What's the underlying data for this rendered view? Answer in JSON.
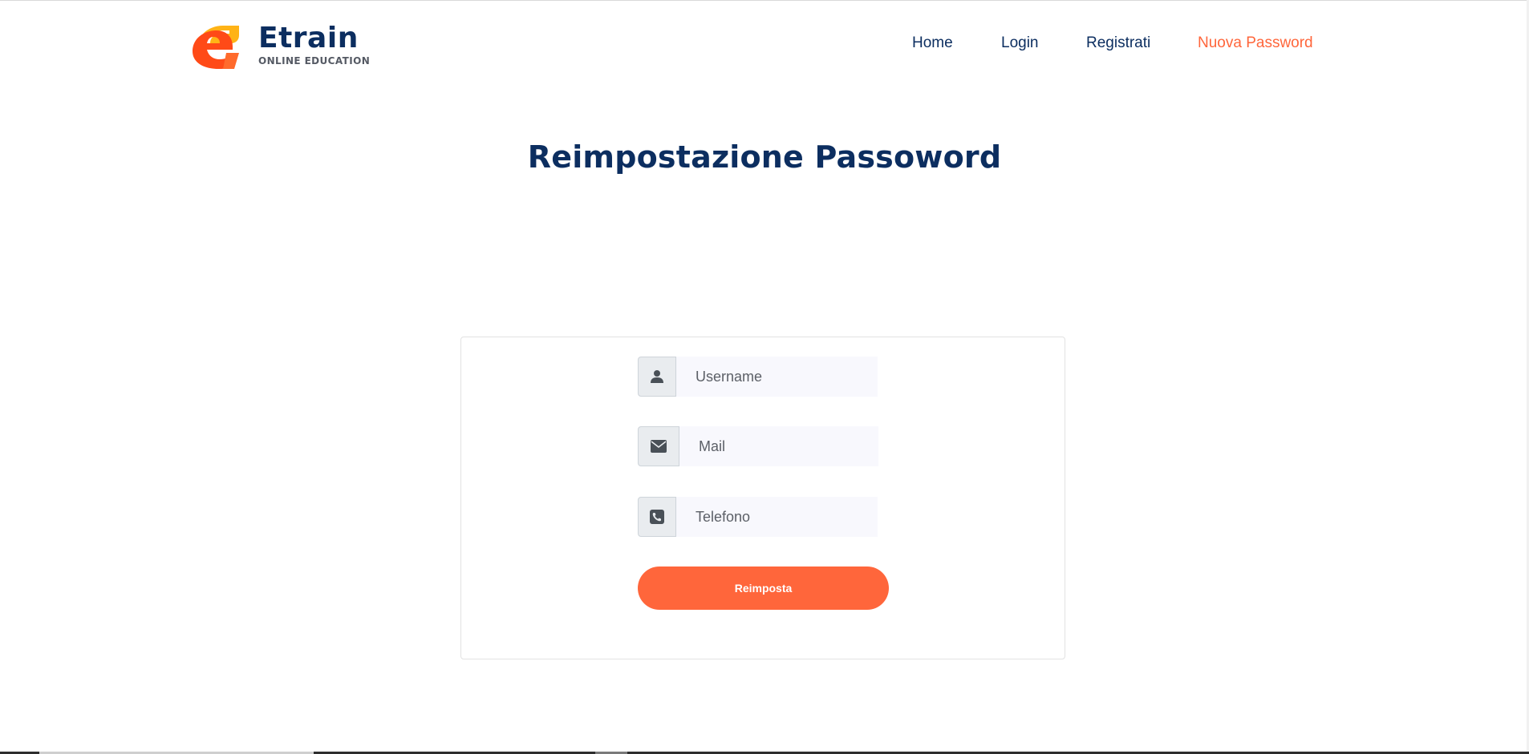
{
  "brand": {
    "name": "Etrain",
    "tagline": "ONLINE EDUCATION",
    "logo_icon": "etrain-e-logo-icon",
    "colors": {
      "primary": "#0c2e60",
      "accent": "#ff663b",
      "logo_yellow": "#ffb316"
    }
  },
  "nav": {
    "items": [
      {
        "label": "Home",
        "active": false
      },
      {
        "label": "Login",
        "active": false
      },
      {
        "label": "Registrati",
        "active": false
      },
      {
        "label": "Nuova Password",
        "active": true
      }
    ]
  },
  "page": {
    "title": "Reimpostazione Passoword"
  },
  "form": {
    "username": {
      "placeholder": "Username",
      "value": "",
      "icon": "user-icon"
    },
    "mail": {
      "placeholder": "Mail",
      "value": "",
      "icon": "envelope-icon"
    },
    "telefono": {
      "placeholder": "Telefono",
      "value": "",
      "icon": "phone-icon"
    },
    "submit_label": "Reimposta"
  }
}
